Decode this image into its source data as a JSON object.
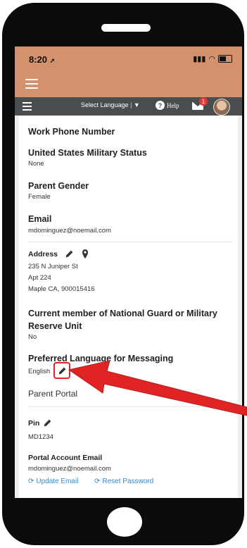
{
  "status_bar": {
    "time": "8:20",
    "signal": "▲"
  },
  "toolbar": {
    "language_select": "Select Language",
    "help_label": "Help",
    "mail_badge": "1"
  },
  "fields": {
    "work_phone": {
      "label": "Work Phone Number"
    },
    "military_status": {
      "label": "United States Military Status",
      "value": "None"
    },
    "parent_gender": {
      "label": "Parent Gender",
      "value": "Female"
    },
    "email": {
      "label": "Email",
      "value": "mdominguez@noemail.com"
    },
    "address": {
      "label": "Address",
      "line1": "235 N Juniper St",
      "line2": "Apt 224",
      "line3": "Maple CA, 900015416"
    },
    "national_guard": {
      "label_line1": "Current member of National Guard or Military",
      "label_line2": "Reserve Unit",
      "value": "No"
    },
    "preferred_language": {
      "label": "Preferred Language for Messaging",
      "value": "English"
    }
  },
  "portal": {
    "title": "Parent Portal",
    "pin_label": "Pin",
    "pin_value": "MD1234",
    "account_email_label": "Portal Account Email",
    "account_email_value": "mdominguez@noemail.com",
    "update_email": "Update Email",
    "reset_password": "Reset Password"
  },
  "colors": {
    "header_bg": "#d3916d",
    "toolbar_bg": "#4a4d50",
    "link": "#2e8ad8",
    "annotation": "#e02323"
  }
}
